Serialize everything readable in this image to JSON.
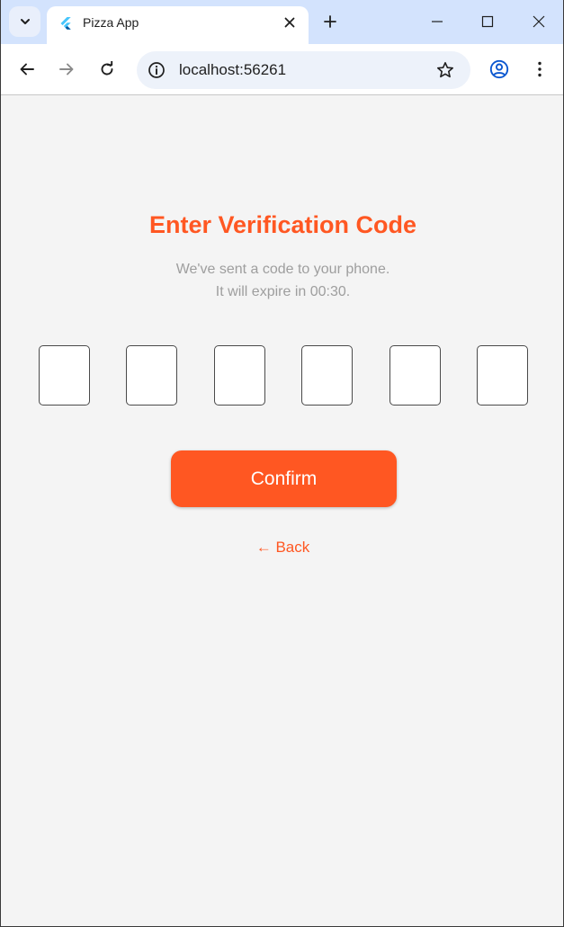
{
  "browser": {
    "tab_title": "Pizza App",
    "url": "localhost:56261",
    "colors": {
      "tabstrip": "#d3e3fd",
      "omnibox": "#edf2fa",
      "accent_icon": "#0b57d0"
    }
  },
  "verification": {
    "title": "Enter Verification Code",
    "subtitle_line1": "We've sent a code to your phone.",
    "subtitle_line2": "It will expire in 00:30.",
    "code_digits": [
      "",
      "",
      "",
      "",
      "",
      ""
    ],
    "confirm_label": "Confirm",
    "back_label": "← Back",
    "colors": {
      "accent": "#ff5722",
      "muted_text": "#9e9e9e",
      "background": "#f4f4f4"
    }
  }
}
